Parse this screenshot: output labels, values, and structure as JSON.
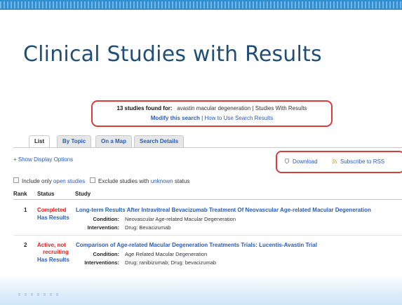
{
  "slide": {
    "title": "Clinical Studies with Results"
  },
  "search": {
    "found_count_text": "13 studies found for:",
    "query": "avastin macular degeneration",
    "filter": "Studies With Results",
    "modify_label": "Modify this search",
    "help_label": "How to Use Search Results"
  },
  "tabs": [
    "List",
    "By Topic",
    "On a Map",
    "Search Details"
  ],
  "options": {
    "show_display_options": "+ Show Display Options",
    "download_label": "Download",
    "subscribe_label": "Subscribe to RSS",
    "include_prefix": "Include only",
    "include_link": "open studies",
    "exclude_prefix": "Exclude studies with",
    "exclude_link": "unknown",
    "exclude_suffix": "status"
  },
  "table": {
    "headers": [
      "Rank",
      "Status",
      "Study"
    ],
    "rows": [
      {
        "rank": "1",
        "status_lines": [
          "Completed"
        ],
        "has_results": "Has Results",
        "title": "Long-term Results After Intravitreal Bevacizumab Treatment Of Neovascular Age-related Macular Degeneration",
        "condition_label": "Condition:",
        "condition": "Neovascular Age-related Macular Degeneration",
        "intervention_label": "Intervention:",
        "intervention": "Drug: Bevacizumab"
      },
      {
        "rank": "2",
        "status_lines": [
          "Active, not",
          "recruiting"
        ],
        "has_results": "Has Results",
        "title": "Comparison of Age-related Macular Degeneration Treatments Trials: Lucentis-Avastin Trial",
        "condition_label": "Condition:",
        "condition": "Age Related Macular Degeneration",
        "intervention_label": "Interventions:",
        "intervention": "Drug: ranibizumab;  Drug: bevacizumab"
      }
    ]
  },
  "colors": {
    "accent": "#2f8fd3",
    "title": "#1f4e79",
    "link": "#2a5db0",
    "highlight_box": "#d63d3d",
    "status_red": "#e02020"
  }
}
